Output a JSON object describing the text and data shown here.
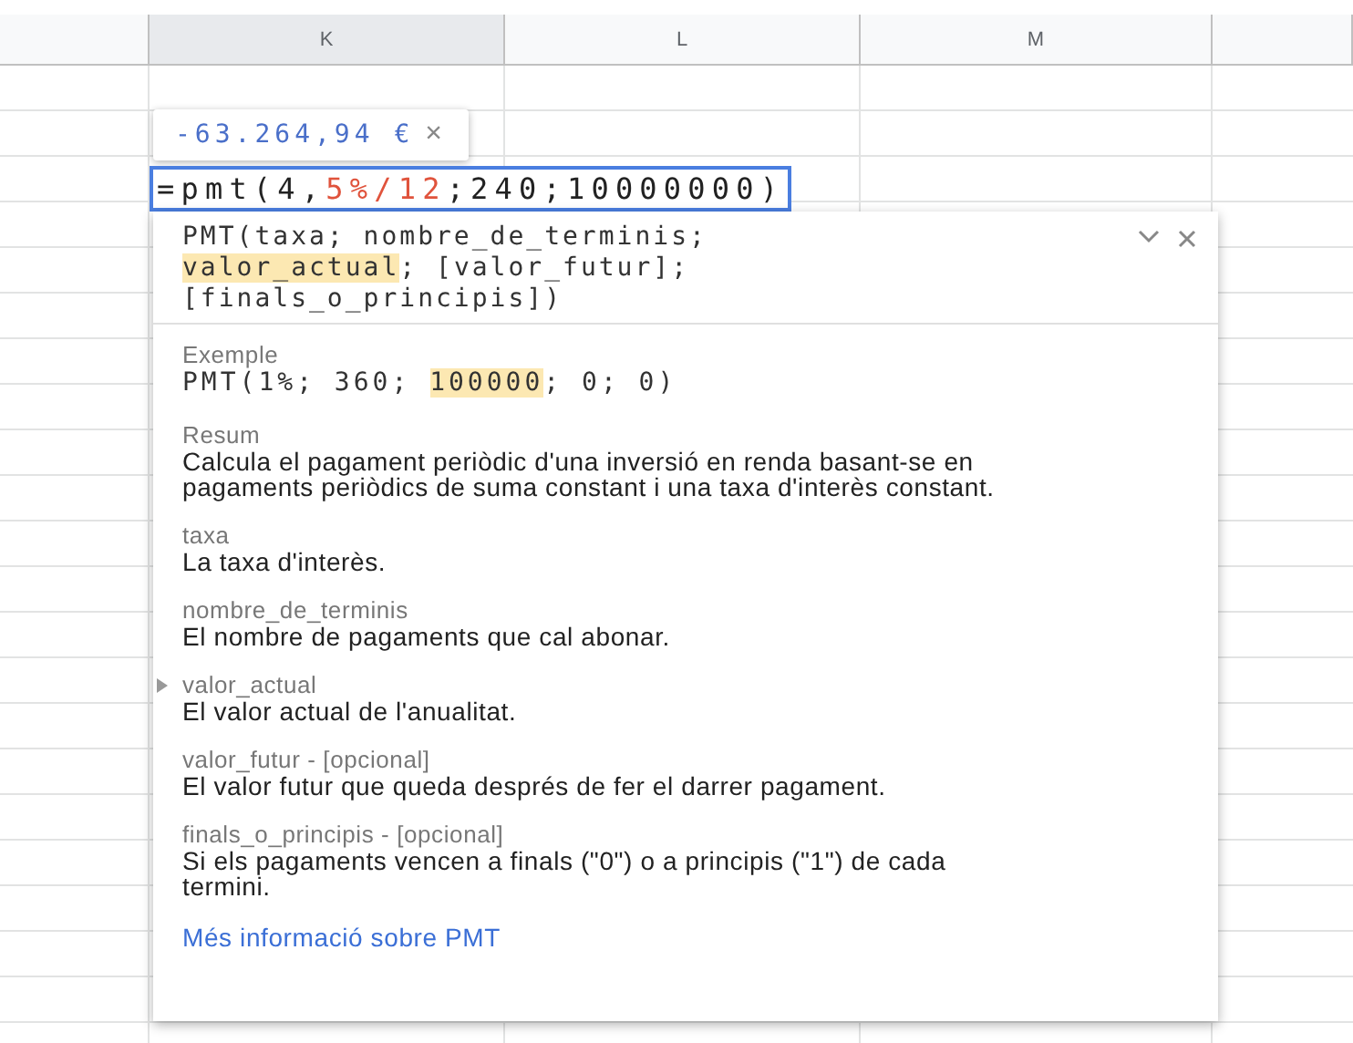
{
  "columns": [
    "K",
    "L",
    "M"
  ],
  "result_preview": {
    "value": "-63.264,94 €",
    "close": "×"
  },
  "formula": [
    {
      "text": "=pmt(4,",
      "highlight": false
    },
    {
      "text": "5%/12",
      "highlight": true
    },
    {
      "text": ";240;10000000)",
      "highlight": false
    }
  ],
  "help": {
    "signature": [
      {
        "text": "PMT(taxa; nombre_de_terminis; ",
        "highlight": false
      },
      {
        "text": "valor_actual",
        "highlight": true
      },
      {
        "text": "; [valor_futur]; [finals_o_principis])",
        "highlight": false
      }
    ],
    "example_label": "Exemple",
    "example": [
      {
        "text": "PMT(1%; 360; ",
        "highlight": false
      },
      {
        "text": "100000",
        "highlight": true
      },
      {
        "text": "; 0; 0)",
        "highlight": false
      }
    ],
    "summary_label": "Resum",
    "summary": "Calcula el pagament periòdic d'una inversió en renda basant-se en pagaments periòdics de suma constant i una taxa d'interès constant.",
    "parameters": [
      {
        "name": "taxa",
        "description": "La taxa d'interès.",
        "current": false
      },
      {
        "name": "nombre_de_terminis",
        "description": "El nombre de pagaments que cal abonar.",
        "current": false
      },
      {
        "name": "valor_actual",
        "description": "El valor actual de l'anualitat.",
        "current": true
      },
      {
        "name": "valor_futur - [opcional]",
        "description": "El valor futur que queda després de fer el darrer pagament.",
        "current": false
      },
      {
        "name": "finals_o_principis - [opcional]",
        "description": "Si els pagaments vencen a finals (\"0\") o a principis (\"1\") de cada termini.",
        "current": false
      }
    ],
    "link": "Més informació sobre PMT"
  }
}
